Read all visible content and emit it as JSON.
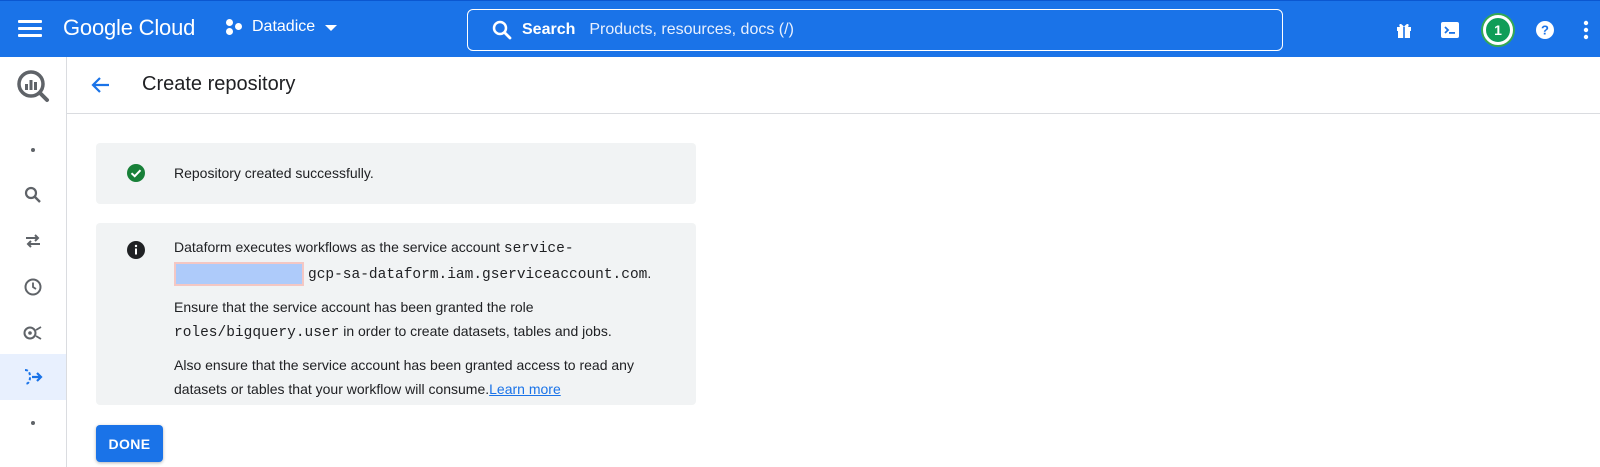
{
  "topbar": {
    "brand": "Google Cloud",
    "project": "Datadice",
    "search_label": "Search",
    "search_placeholder": "Products, resources, docs (/)",
    "notification_count": "1",
    "icons": [
      "menu-icon",
      "project-icon",
      "search-icon",
      "gift-icon",
      "cloud-shell-icon",
      "help-icon",
      "more-vert-icon"
    ]
  },
  "rail": {
    "icons": [
      "bigquery-logo-icon",
      "dot-icon",
      "search-icon",
      "transfer-icon",
      "history-icon",
      "analytics-icon",
      "dataform-icon",
      "dot-icon"
    ],
    "active": "dataform-icon"
  },
  "header": {
    "title": "Create repository"
  },
  "success_banner": {
    "text": "Repository created successfully."
  },
  "info_banner": {
    "line1_prefix": "Dataform executes workflows as the service account ",
    "line1_code": "service-",
    "line2_code": "gcp-sa-dataform.iam.gserviceaccount.com",
    "line2_suffix": ".",
    "para2_prefix": "Ensure that the service account has been granted the role ",
    "para2_code": "roles/bigquery.user",
    "para2_suffix": " in order to create datasets, tables and jobs.",
    "para3_text": "Also ensure that the service account has been granted access to read any datasets or tables that your workflow will consume.",
    "learn_more": "Learn more"
  },
  "actions": {
    "done_label": "DONE"
  },
  "colors": {
    "accent": "#1a73e8",
    "success": "#188038",
    "banner_bg": "#f1f3f4"
  }
}
